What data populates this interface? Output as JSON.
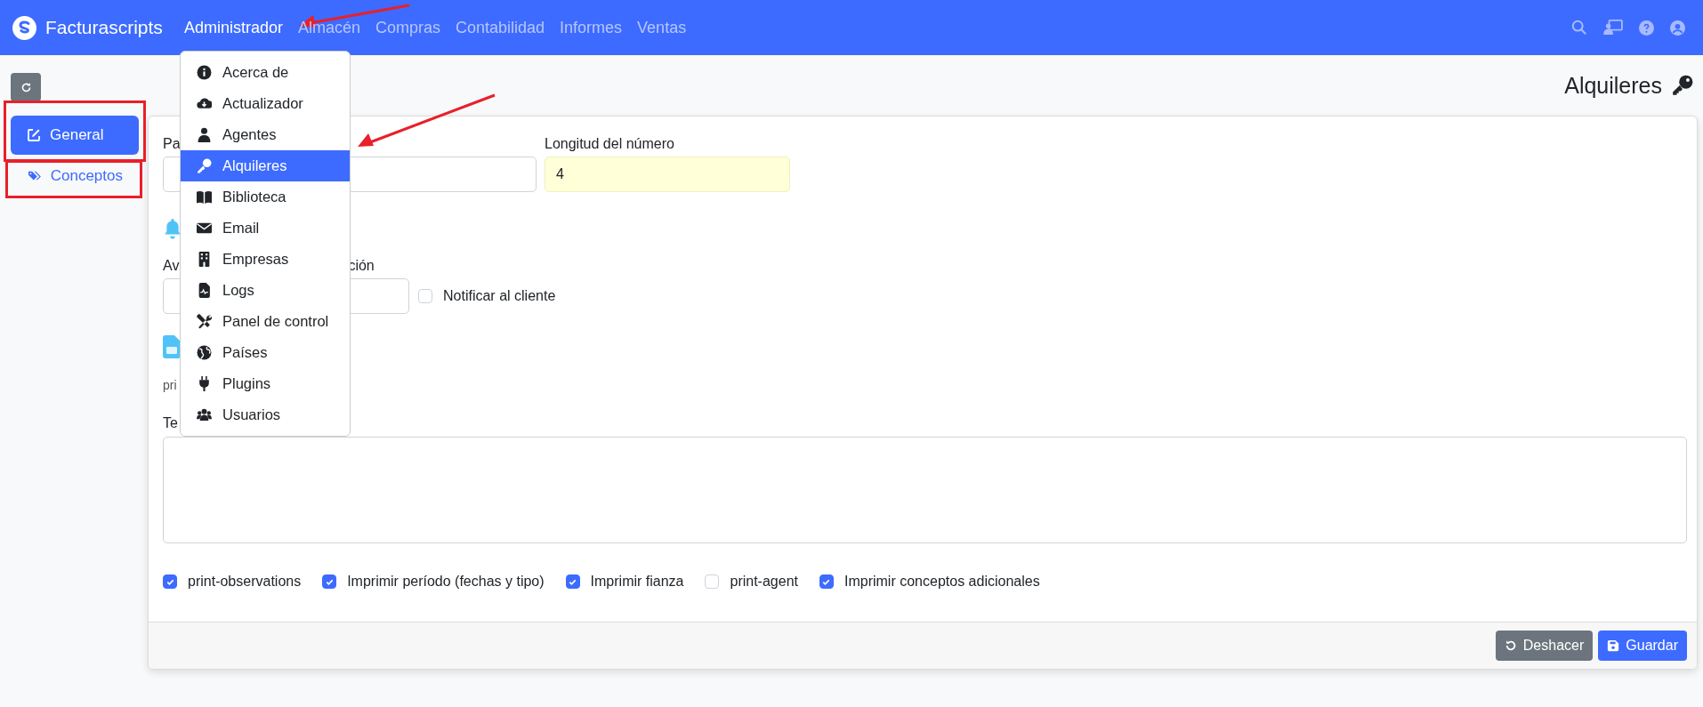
{
  "navbar": {
    "brand": "Facturascripts",
    "menu": [
      {
        "label": "Administrador",
        "selected": true
      },
      {
        "label": "Almacén",
        "selected": false
      },
      {
        "label": "Compras",
        "selected": false
      },
      {
        "label": "Contabilidad",
        "selected": false
      },
      {
        "label": "Informes",
        "selected": false
      },
      {
        "label": "Ventas",
        "selected": false
      }
    ]
  },
  "dropdown": {
    "items": [
      {
        "label": "Acerca de",
        "selected": false
      },
      {
        "label": "Actualizador",
        "selected": false
      },
      {
        "label": "Agentes",
        "selected": false
      },
      {
        "label": "Alquileres",
        "selected": true
      },
      {
        "label": "Biblioteca",
        "selected": false
      },
      {
        "label": "Email",
        "selected": false
      },
      {
        "label": "Empresas",
        "selected": false
      },
      {
        "label": "Logs",
        "selected": false
      },
      {
        "label": "Panel de control",
        "selected": false
      },
      {
        "label": "Países",
        "selected": false
      },
      {
        "label": "Plugins",
        "selected": false
      },
      {
        "label": "Usuarios",
        "selected": false
      }
    ]
  },
  "sidebar": {
    "items": [
      {
        "label": "General",
        "selected": true
      },
      {
        "label": "Conceptos",
        "selected": false
      }
    ]
  },
  "page_title": "Alquileres",
  "form": {
    "field_1": {
      "label": "Pa"
    },
    "number_length": {
      "label": "Longitud del número",
      "value": "4"
    },
    "field_3": {
      "label_start": "Av",
      "label_end": "ción"
    },
    "notify": {
      "label": "Notificar al cliente",
      "checked": false
    },
    "caption": "pri",
    "textarea_label": "Te",
    "options": [
      {
        "label": "print-observations",
        "checked": true
      },
      {
        "label": "Imprimir período (fechas y tipo)",
        "checked": true
      },
      {
        "label": "Imprimir fianza",
        "checked": true
      },
      {
        "label": "print-agent",
        "checked": false
      },
      {
        "label": "Imprimir conceptos adicionales",
        "checked": true
      }
    ]
  },
  "footer_buttons": [
    {
      "label": "Deshacer",
      "kind": "secondary"
    },
    {
      "label": "Guardar",
      "kind": "primary"
    }
  ]
}
